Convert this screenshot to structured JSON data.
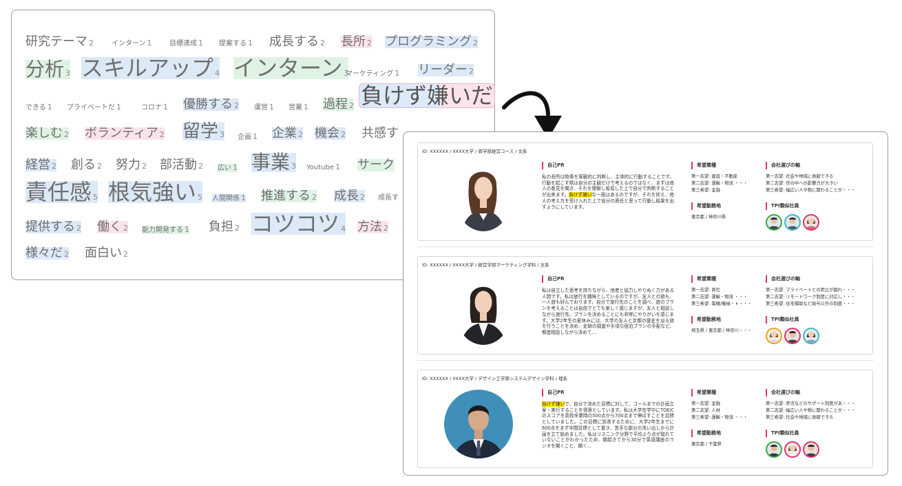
{
  "word_cloud": {
    "words": [
      {
        "text": "研究テーマ",
        "count": "2"
      },
      {
        "text": "インターン",
        "count": "1"
      },
      {
        "text": "目標達成",
        "count": "1"
      },
      {
        "text": "提案する",
        "count": "1"
      },
      {
        "text": "成長する",
        "count": "2"
      },
      {
        "text": "長所",
        "count": "2"
      },
      {
        "text": "プログラミング",
        "count": "2"
      },
      {
        "text": "分析",
        "count": "3"
      },
      {
        "text": "スキルアップ",
        "count": "4"
      },
      {
        "text": "インターン",
        "count": "3"
      },
      {
        "text": "マーケティング",
        "count": "1"
      },
      {
        "text": "リーダー",
        "count": "2"
      },
      {
        "text": "できる",
        "count": "1"
      },
      {
        "text": "プライベートだ",
        "count": "1"
      },
      {
        "text": "コロナ",
        "count": "1"
      },
      {
        "text": "優勝する",
        "count": "2"
      },
      {
        "text": "運営",
        "count": "1"
      },
      {
        "text": "営業",
        "count": "1"
      },
      {
        "text": "過程",
        "count": "2"
      },
      {
        "text": "負けず嫌いだ",
        "count": ""
      },
      {
        "text": "楽しむ",
        "count": "2"
      },
      {
        "text": "ボランティア",
        "count": "2"
      },
      {
        "text": "留学",
        "count": "3"
      },
      {
        "text": "企画",
        "count": "1"
      },
      {
        "text": "企業",
        "count": "2"
      },
      {
        "text": "機会",
        "count": "2"
      },
      {
        "text": "共感す",
        "count": ""
      },
      {
        "text": "経営",
        "count": "2"
      },
      {
        "text": "創る",
        "count": "2"
      },
      {
        "text": "努力",
        "count": "2"
      },
      {
        "text": "部活動",
        "count": "2"
      },
      {
        "text": "広い",
        "count": "1"
      },
      {
        "text": "事業",
        "count": "3"
      },
      {
        "text": "Youtube",
        "count": "1"
      },
      {
        "text": "サーク",
        "count": ""
      },
      {
        "text": "責任感",
        "count": "5"
      },
      {
        "text": "根気強い",
        "count": "5"
      },
      {
        "text": "人間関係",
        "count": "1"
      },
      {
        "text": "推進する",
        "count": "2"
      },
      {
        "text": "成長",
        "count": "2"
      },
      {
        "text": "成長す",
        "count": ""
      },
      {
        "text": "提供する",
        "count": "2"
      },
      {
        "text": "働く",
        "count": "2"
      },
      {
        "text": "能力開発する",
        "count": "1"
      },
      {
        "text": "負担",
        "count": "2"
      },
      {
        "text": "コツコツ",
        "count": "4"
      },
      {
        "text": "方法",
        "count": "2"
      },
      {
        "text": "様々だ",
        "count": "2"
      },
      {
        "text": "面白い",
        "count": "2"
      }
    ]
  },
  "labels": {
    "pr": "自己PR",
    "industry": "希望業種",
    "location": "希望勤務地",
    "axis": "会社選びの軸",
    "similar": "TPI類似社員"
  },
  "colors": {
    "accent": "#e0336b",
    "highlight": "#ffe400"
  },
  "cards": [
    {
      "id": "ID: XXXXXX / XXXX大学 / 商学部経営コース / 文系",
      "pr_mark": "負けず嫌い",
      "pr_before": "私の長所は物事を客観的に判断し、主体的に行動することです。行動を起こす際は自分の主観だけで考えるのではなく、まずは他人の意見を聞き、それを理解し吸収した上で自分で判断することが出来ます。",
      "pr_after": "な一面はあるのですが、それを抑え、他人の考え方を受け入れた上で自分の責任と思って行動し結果を出すようにしています。",
      "industries": [
        "第一志望: 建設・不動産",
        "第二志望: 運輸・物流 ・・・",
        "第三希望: 金融"
      ],
      "location": "東京都 / 神奈川県",
      "axes": [
        "第一志望: 社会や地域に貢献できる",
        "第二志望: 世の中への影響力が大きい",
        "第三希望: 幅広い人や物に関わることが・・・"
      ]
    },
    {
      "id": "ID: XXXXXX / XXXX大学 / 経営学部マーケティング学科 / 文系",
      "pr_mark": "",
      "pr_before": "私は自立した思考を持ちながら、他者と協力しやりぬく力がある人間です。私は旅行を趣味としているのですが、友人との旅も、一人旅も好んでおります。自分で旅行先のことを調べ、旅のプランを考えることは自由でとても楽しく感じますが、友人と相談しながら旅行先、プランを決めることにも非常にやりがいを感じます。大学2年生の夏休みには、大学の友人と京都の歴史を辿る旅を行うことを決め、史跡の調査や手頃な宿泊プランの手配など、都度相談しながら決めて...",
      "pr_after": "",
      "industries": [
        "第一志望: 商社",
        "第二志望: 運輸・物流 ・・・",
        "第三希望: 電機/機械・ト・・・"
      ],
      "location": "埼玉県 / 東京都 / 神奈川・・・",
      "axes": [
        "第一志望: プライベートとの両立が図れ・・・",
        "第二志望: リモートワーク制度に対応し・・・",
        "第三希望: 住宅補助など給与以外の制度・・・"
      ]
    },
    {
      "id": "ID: XXXXXX / XXXX大学 / デザイン工学部システムデザイン学科 / 理系",
      "pr_mark": "負けず嫌い",
      "pr_before": "",
      "pr_after": "で、自分で決めた目標に対して、ゴールまでの計画立案・実行することを得意としています。私は大学在学中にTOEICのスコアを高校卒業時の500点から700点まで伸ばすことを目標としていました。この目標に到達するために、大学2年生までに600点をまず中間目標として置き、苦手な部分の洗い出しから計画を立て始めました。私はリスニング分野で平均より点が取れていないことがわかったため、朝起きてから30分で英語講座のラジオを聞くこと、聞く...",
      "industries": [
        "第一志望: 金融",
        "第二志望: 人材",
        "第三希望: 運輸・物流 ・・・"
      ],
      "location": "東京都 / 千葉県",
      "axes": [
        "第一志望: 育児などのサポート制度があ・・・",
        "第二志望: 幅広い人や物に関わることが・・・",
        "第三希望: 社会や地域に貢献できる"
      ]
    }
  ]
}
